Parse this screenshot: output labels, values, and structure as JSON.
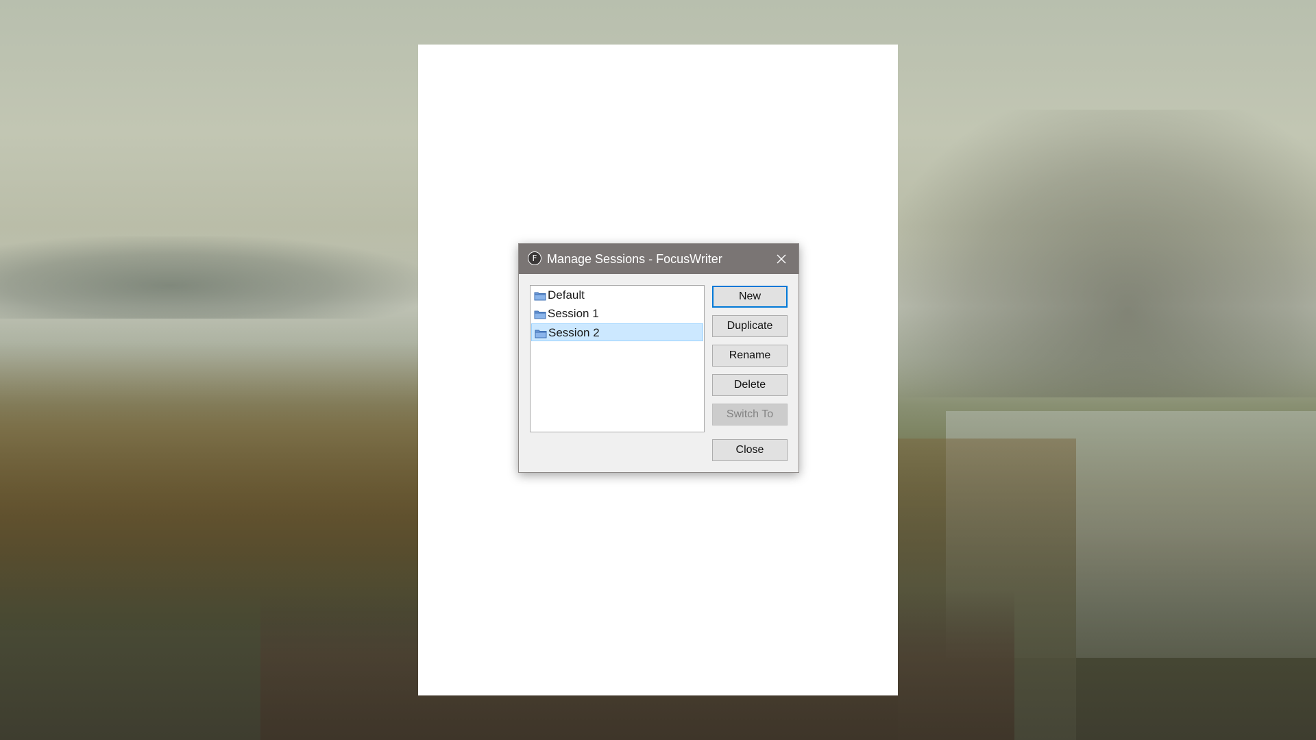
{
  "dialog": {
    "title": "Manage Sessions - FocusWriter",
    "app_icon_letter": "F",
    "sessions": [
      {
        "label": "Default",
        "selected": false
      },
      {
        "label": "Session 1",
        "selected": false
      },
      {
        "label": "Session 2",
        "selected": true
      }
    ],
    "buttons": {
      "new": "New",
      "duplicate": "Duplicate",
      "rename": "Rename",
      "delete": "Delete",
      "switch_to": "Switch To",
      "close": "Close"
    }
  },
  "colors": {
    "titlebar": "#7a7574",
    "selection_bg": "#cce8ff",
    "default_button_border": "#0078d7"
  },
  "icons": {
    "app": "focuswriter-app-icon",
    "close": "close-icon",
    "session": "folder-icon"
  }
}
